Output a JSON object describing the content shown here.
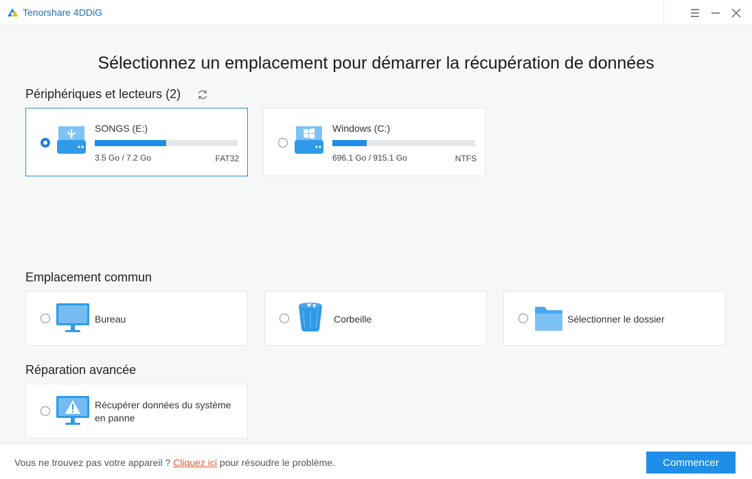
{
  "window": {
    "title": "Tenorshare 4DDiG",
    "brand_color": "#1f8ee8"
  },
  "header": {
    "title": "Sélectionnez un emplacement pour démarrer la récupération de données"
  },
  "devices": {
    "title": "Périphériques et lecteurs (2)",
    "items": [
      {
        "name": "SONGS (E:)",
        "size": "3.5 Go / 7.2 Go",
        "fs": "FAT32",
        "used_fraction": 0.5,
        "selected": true,
        "icon": "usb-drive-icon"
      },
      {
        "name": "Windows (C:)",
        "size": "696.1 Go / 915.1 Go",
        "fs": "NTFS",
        "used_fraction": 0.24,
        "selected": false,
        "icon": "windows-drive-icon"
      }
    ]
  },
  "common": {
    "title": "Emplacement commun",
    "items": [
      {
        "label": "Bureau",
        "icon": "desktop-monitor-icon"
      },
      {
        "label": "Corbeille",
        "icon": "recycle-bin-icon"
      },
      {
        "label": "Sélectionner le dossier",
        "icon": "folder-icon"
      }
    ]
  },
  "advanced": {
    "title": "Réparation avancée",
    "items": [
      {
        "label_line1": "Récupérer données du système",
        "label_line2": "en panne",
        "icon": "crashed-system-monitor-icon"
      }
    ]
  },
  "footer": {
    "text_before": "Vous ne trouvez pas votre appareil ? ",
    "link": "Cliquez ici",
    "text_after": " pour résoudre le problème.",
    "start_label": "Commencer"
  }
}
